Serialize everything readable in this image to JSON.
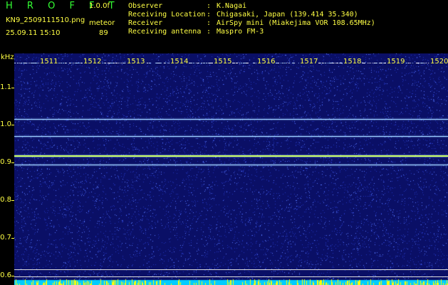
{
  "header": {
    "app_title": "H R O F F T",
    "app_version": "1.0.0f",
    "file_name": "KN9_2509111510.png",
    "station_label": "meteor",
    "timestamp": "25.09.11 15:10",
    "count_value": "89",
    "meta": [
      {
        "key": "Observer",
        "sep": ":",
        "value": "K.Nagai"
      },
      {
        "key": "Receiving Location",
        "sep": ":",
        "value": "Chigasaki, Japan (139.414 35.340)"
      },
      {
        "key": "Receiver",
        "sep": ":",
        "value": "AirSpy mini (Miakejima VOR 108.65MHz)"
      },
      {
        "key": "Receiving antenna",
        "sep": ":",
        "value": "Maspro FM-3"
      }
    ]
  },
  "axis": {
    "unit": "kHz",
    "yticks": [
      "1.1",
      "1.0",
      "0.9",
      "0.8",
      "0.7",
      "0.6"
    ],
    "minute_labels": [
      "1511",
      "1512",
      "1513",
      "1514",
      "1515",
      "1516",
      "1517",
      "1518",
      "1519",
      "1520"
    ]
  },
  "spectrogram": {
    "y_range_khz": [
      0.575,
      1.19
    ],
    "carrier_lines_khz": [
      1.015,
      0.97,
      0.92,
      0.895,
      0.617,
      0.598
    ],
    "colors": {
      "background": "#0a0f66",
      "noise_low": "#2233bb",
      "noise_high": "#5577ff",
      "carrier": "#99ccff",
      "strong_carrier": "#ccff66",
      "baseline": "#dddddd",
      "bottom_bar": "#00ccff",
      "bottom_spikes": "#ffff00",
      "axis_text": "#ffff44"
    }
  }
}
